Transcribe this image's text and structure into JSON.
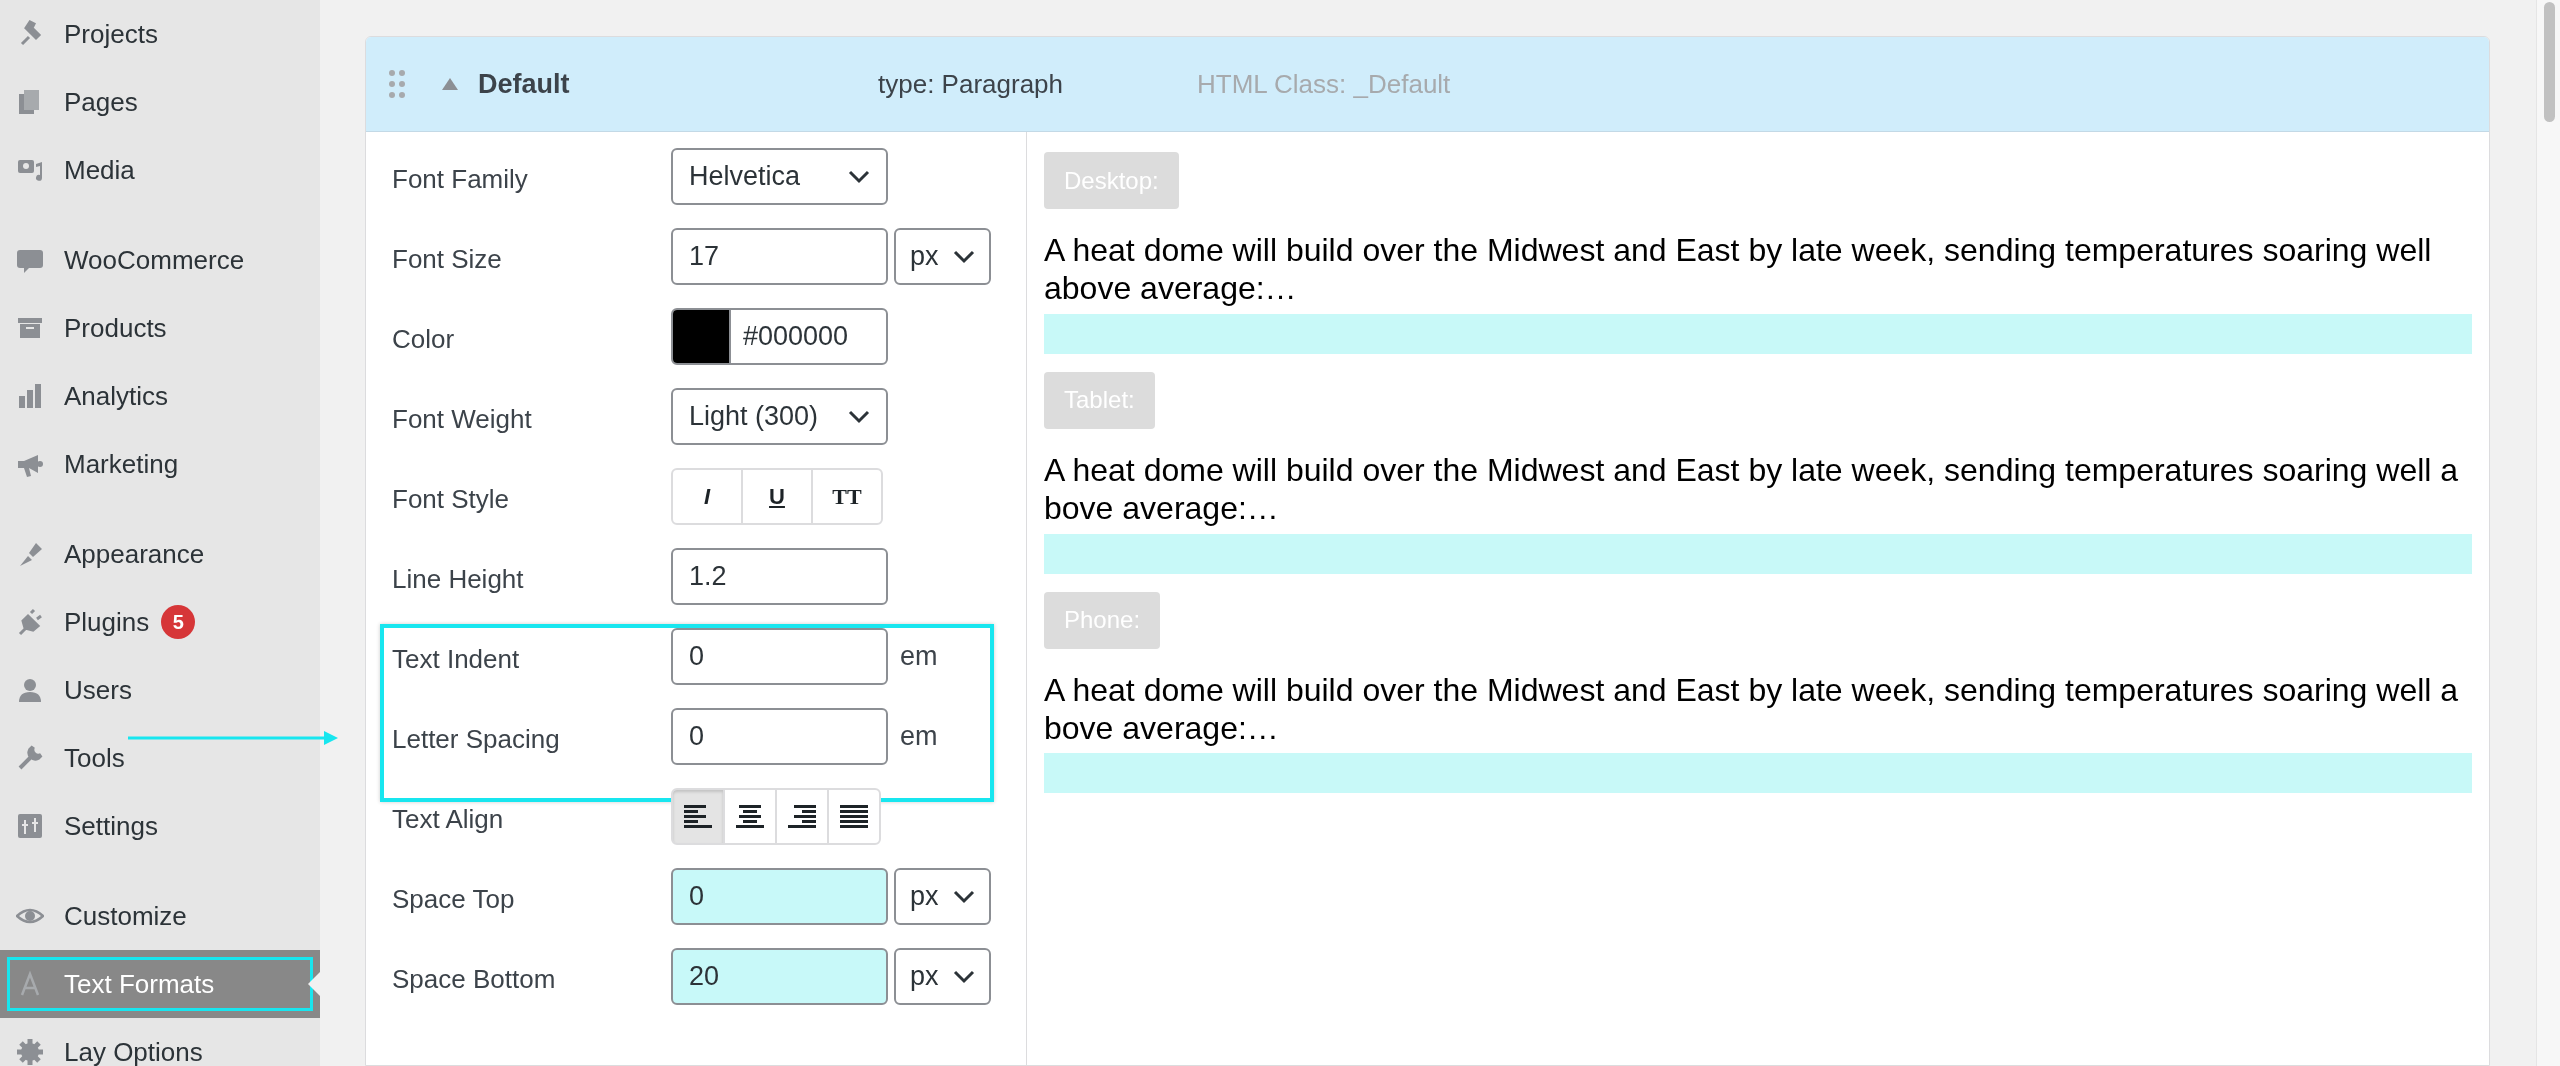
{
  "sidebar": {
    "groups": [
      [
        {
          "label": "Projects",
          "selected": false,
          "outlined": false
        },
        {
          "label": "Pages",
          "selected": false,
          "outlined": false
        },
        {
          "label": "Media",
          "selected": false,
          "outlined": false
        }
      ],
      [
        {
          "label": "WooCommerce",
          "selected": false,
          "outlined": false
        },
        {
          "label": "Products",
          "selected": false,
          "outlined": false
        },
        {
          "label": "Analytics",
          "selected": false,
          "outlined": false
        },
        {
          "label": "Marketing",
          "selected": false,
          "outlined": false
        }
      ],
      [
        {
          "label": "Appearance",
          "selected": false,
          "outlined": false
        },
        {
          "label": "Plugins",
          "selected": false,
          "outlined": false,
          "badge": "5"
        },
        {
          "label": "Users",
          "selected": false,
          "outlined": false
        },
        {
          "label": "Tools",
          "selected": false,
          "outlined": false
        },
        {
          "label": "Settings",
          "selected": false,
          "outlined": false
        }
      ],
      [
        {
          "label": "Customize",
          "selected": false,
          "outlined": false
        },
        {
          "label": "Text Formats",
          "selected": true,
          "outlined": true
        },
        {
          "label": "Lay Options",
          "selected": false,
          "outlined": false
        }
      ]
    ]
  },
  "annotation_arrow": true,
  "format": {
    "title": "Default",
    "expanded": true,
    "type": "type: Paragraph",
    "html_class": "HTML Class: _Default",
    "sections": [
      {
        "outlined": false,
        "rows": [
          {
            "kind": "select",
            "label": "Font Family",
            "value": "Helvetica"
          },
          {
            "kind": "number_select",
            "label": "Font Size",
            "value": "17",
            "unit": "px",
            "tinted": false
          },
          {
            "kind": "color",
            "label": "Color",
            "value": "#000000",
            "color": "#000000"
          },
          {
            "kind": "select",
            "label": "Font Weight",
            "value": "Light (300)"
          },
          {
            "kind": "styles",
            "label": "Font Style",
            "options": [
              {
                "label": "I",
                "kind": "italic",
                "selected": false
              },
              {
                "label": "U",
                "kind": "underline",
                "selected": false
              },
              {
                "label": "TT",
                "kind": "caps",
                "selected": false
              }
            ]
          },
          {
            "kind": "input",
            "label": "Line Height",
            "value": "1.2"
          }
        ]
      },
      {
        "outlined": true,
        "rows": [
          {
            "kind": "number_unit",
            "label": "Text Indent",
            "value": "0",
            "unit": "em"
          },
          {
            "kind": "number_unit",
            "label": "Letter Spacing",
            "value": "0",
            "unit": "em"
          }
        ]
      },
      {
        "outlined": false,
        "rows": [
          {
            "kind": "align",
            "label": "Text Align",
            "options": [
              {
                "kind": "left",
                "selected": true
              },
              {
                "kind": "center",
                "selected": false
              },
              {
                "kind": "right",
                "selected": false
              },
              {
                "kind": "justify",
                "selected": false
              }
            ]
          },
          {
            "kind": "number_select",
            "label": "Space Top",
            "value": "0",
            "unit": "px",
            "tinted": true
          },
          {
            "kind": "number_select",
            "label": "Space Bottom",
            "value": "20",
            "unit": "px",
            "tinted": true
          }
        ]
      }
    ]
  },
  "previews": [
    {
      "device": "Desktop:",
      "text": "A heat dome will build over the Midwest and East by late week, sending temperatures soaring well above average:…",
      "break_anywhere": false
    },
    {
      "device": "Tablet:",
      "text": "A heat dome will build over the Midwest and East by late week, sending temperatures soaring well above average:…",
      "break_anywhere": true
    },
    {
      "device": "Phone:",
      "text": "A heat dome will build over the Midwest and East by late week, sending temperatures soaring well above average:…",
      "break_anywhere": true
    }
  ]
}
